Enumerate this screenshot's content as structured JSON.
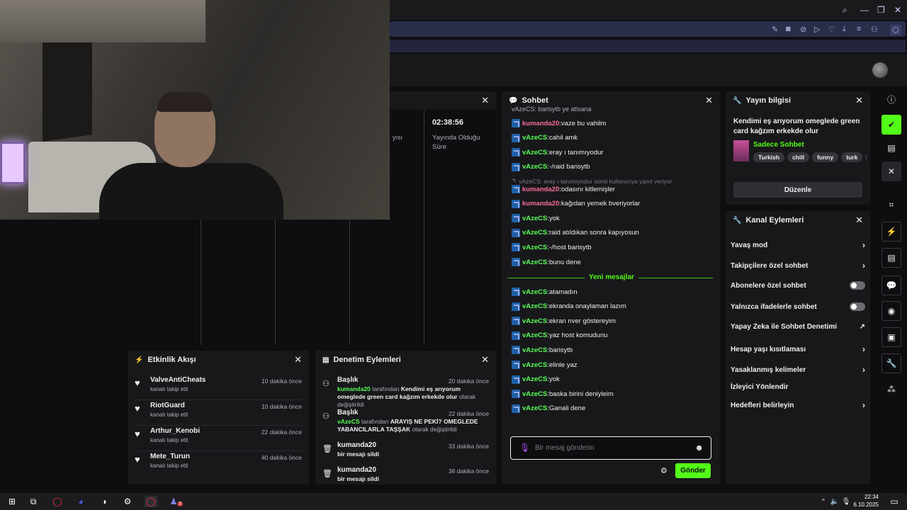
{
  "app_bar": {
    "avatar_alt": ""
  },
  "stream_info_partial": {
    "timer": "02:38:56",
    "timer_label": "Yayında Olduğu Süre",
    "cut_text": "yısı"
  },
  "chat": {
    "title": "Sohbet",
    "top_cut": "vAzeCS: barisytb ye atlsana",
    "messages": [
      {
        "user": "kumanda20",
        "color": "pink",
        "text": "vaze bu vahilm"
      },
      {
        "user": "vAzeCS",
        "color": "green",
        "text": "cahil amk"
      },
      {
        "user": "vAzeCS",
        "color": "green",
        "text": "eray ı tanımıyodur"
      },
      {
        "user": "vAzeCS",
        "color": "green",
        "text": "-/raid barisytb"
      }
    ],
    "reply_hint": "vAzeCS: eray ı tanımıyodur isimli kullanıcıya yanıt veriyor",
    "messages2": [
      {
        "user": "kumanda20",
        "color": "pink",
        "text": "odasını kitlemişler"
      },
      {
        "user": "kumanda20",
        "color": "pink",
        "text": "kağıdan yemek bveriyorlar"
      },
      {
        "user": "vAzeCS",
        "color": "green",
        "text": "yok"
      },
      {
        "user": "vAzeCS",
        "color": "green",
        "text": "raid atıldıkan sonra kapıyosun"
      },
      {
        "user": "vAzeCS",
        "color": "green",
        "text": "-/host barisytb"
      },
      {
        "user": "vAzeCS",
        "color": "green",
        "text": "bunu dene"
      }
    ],
    "new_messages_label": "Yeni mesajlar",
    "messages3": [
      {
        "user": "vAzeCS",
        "color": "green",
        "text": "atamadın"
      },
      {
        "user": "vAzeCS",
        "color": "green",
        "text": "ekranda onaylaman lazım"
      },
      {
        "user": "vAzeCS",
        "color": "green",
        "text": "ekran nver göstereyim"
      },
      {
        "user": "vAzeCS",
        "color": "green",
        "text": "yaz host komudunu"
      },
      {
        "user": "vAzeCS",
        "color": "green",
        "text": "barisytb"
      },
      {
        "user": "vAzeCS",
        "color": "green",
        "text": "elinle yaz"
      },
      {
        "user": "vAzeCS",
        "color": "green",
        "text": "yok"
      },
      {
        "user": "vAzeCS",
        "color": "green",
        "text": "baska birini deniyleim"
      },
      {
        "user": "vAzeCS",
        "color": "green",
        "text": "Ganali dene"
      }
    ],
    "input_placeholder": "Bir mesaj gönderin",
    "send_label": "Gönder"
  },
  "stream_info": {
    "title": "Yayın bilgisi",
    "stream_title": "Kendimi eş arıyorum omeglede green card kağzım erkekde olur",
    "category": "Sadece Sohbet",
    "tags": [
      "Turkish",
      "chill",
      "funny",
      "turk",
      "t"
    ],
    "edit_label": "Düzenle"
  },
  "channel_actions": {
    "title": "Kanal Eylemleri",
    "items": [
      {
        "label": "Yavaş mod",
        "control": "chevron"
      },
      {
        "label": "Takipçilere özel sohbet",
        "control": "chevron"
      },
      {
        "label": "Abonelere özel sohbet",
        "control": "toggle"
      },
      {
        "label": "Yalnızca ifadelerle sohbet",
        "control": "toggle"
      },
      {
        "label": "Yapay Zeka ile Sohbet Denetimi",
        "control": "external"
      },
      {
        "label": "Hesap yaşı kısıtlaması",
        "control": "chevron"
      },
      {
        "label": "Yasaklanmış kelimeler",
        "control": "chevron"
      },
      {
        "label": "İzleyici Yönlendir",
        "control": "none"
      },
      {
        "label": "Hedefleri belirleyin",
        "control": "chevron"
      }
    ]
  },
  "activity": {
    "title": "Etkinlik Akışı",
    "items": [
      {
        "name": "ValveAntiCheats",
        "sub": "kanalı takip etti",
        "time": "10 dakika önce"
      },
      {
        "name": "RiotGuard",
        "sub": "kanalı takip etti",
        "time": "10 dakika önce"
      },
      {
        "name": "Arthur_Kenobi",
        "sub": "kanalı takip etti",
        "time": "22 dakika önce"
      },
      {
        "name": "Mete_Turun",
        "sub": "kanalı takip etti",
        "time": "40 dakika önce"
      }
    ]
  },
  "mod_actions": {
    "title": "Denetim Eylemleri",
    "items": [
      {
        "name": "Başlık",
        "time": "20 dakika önce",
        "by": "kumanda20",
        "mid": "tarafından",
        "value": "Kendimi eş arıyorum omeglede green card kağzım erkekde olur",
        "tail": "olarak değiştirildi"
      },
      {
        "name": "Başlık",
        "time": "22 dakika önce",
        "by": "vAzeCS",
        "mid": "tarafından",
        "value": "ARAYIŞ NE PEKİ? OMEGLEDE YABANCILARLA TAŞŞAK",
        "tail": "olarak değiştirildi"
      },
      {
        "name": "kumanda20",
        "time": "33 dakika önce",
        "desc": "bir mesajı sildi"
      },
      {
        "name": "kumanda20",
        "time": "38 dakika önce",
        "desc": "bir mesajı sildi"
      }
    ]
  },
  "taskbar": {
    "time": "22:34",
    "date": "6.10.2025",
    "badge": "3"
  },
  "colors": {
    "accent": "#53fc18",
    "bg": "#0e0e10",
    "panel": "#18181b",
    "green_user": "#57ff57",
    "pink_user": "#ff6e9b"
  }
}
